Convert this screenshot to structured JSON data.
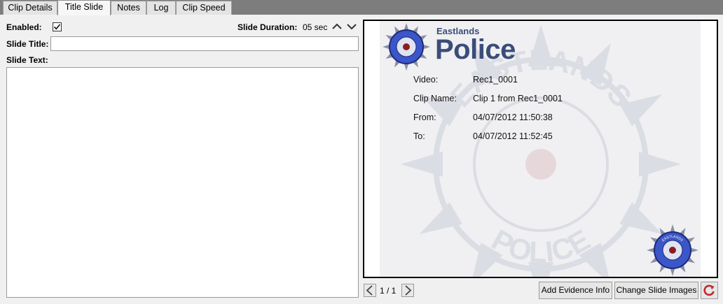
{
  "tabs": [
    {
      "label": "Clip Details",
      "active": false
    },
    {
      "label": "Title Slide",
      "active": true
    },
    {
      "label": "Notes",
      "active": false
    },
    {
      "label": "Log",
      "active": false
    },
    {
      "label": "Clip Speed",
      "active": false
    }
  ],
  "form": {
    "enabled_label": "Enabled:",
    "enabled_checked": true,
    "duration_label": "Slide Duration:",
    "duration_value": "05 sec",
    "title_label": "Slide Title:",
    "title_value": "",
    "text_label": "Slide Text:",
    "text_value": ""
  },
  "slide": {
    "brand_top": "Eastlands",
    "brand_main": "Police",
    "fields": [
      {
        "label": "Video:",
        "value": "Rec1_0001"
      },
      {
        "label": "Clip Name:",
        "value": "Clip 1 from Rec1_0001"
      },
      {
        "label": "From:",
        "value": "04/07/2012 11:50:38"
      },
      {
        "label": "To:",
        "value": "04/07/2012 11:52:45"
      }
    ],
    "badge_text": "EASTLANDS",
    "watermark_top": "EASTLANDS",
    "watermark_bottom": "POLICE"
  },
  "nav": {
    "page_indicator": "1 / 1"
  },
  "buttons": {
    "add_evidence": "Add Evidence Info",
    "change_images": "Change Slide Images"
  },
  "icons": {
    "prev": "chevron-left-icon",
    "next": "chevron-right-icon",
    "up": "chevron-up-icon",
    "down": "chevron-down-icon",
    "refresh": "refresh-icon",
    "check": "checkmark-icon"
  },
  "colors": {
    "tab_strip": "#7d7d7d",
    "brand": "#3a4d7a",
    "badge_blue": "#3b56c8",
    "refresh_red": "#c0282d"
  }
}
